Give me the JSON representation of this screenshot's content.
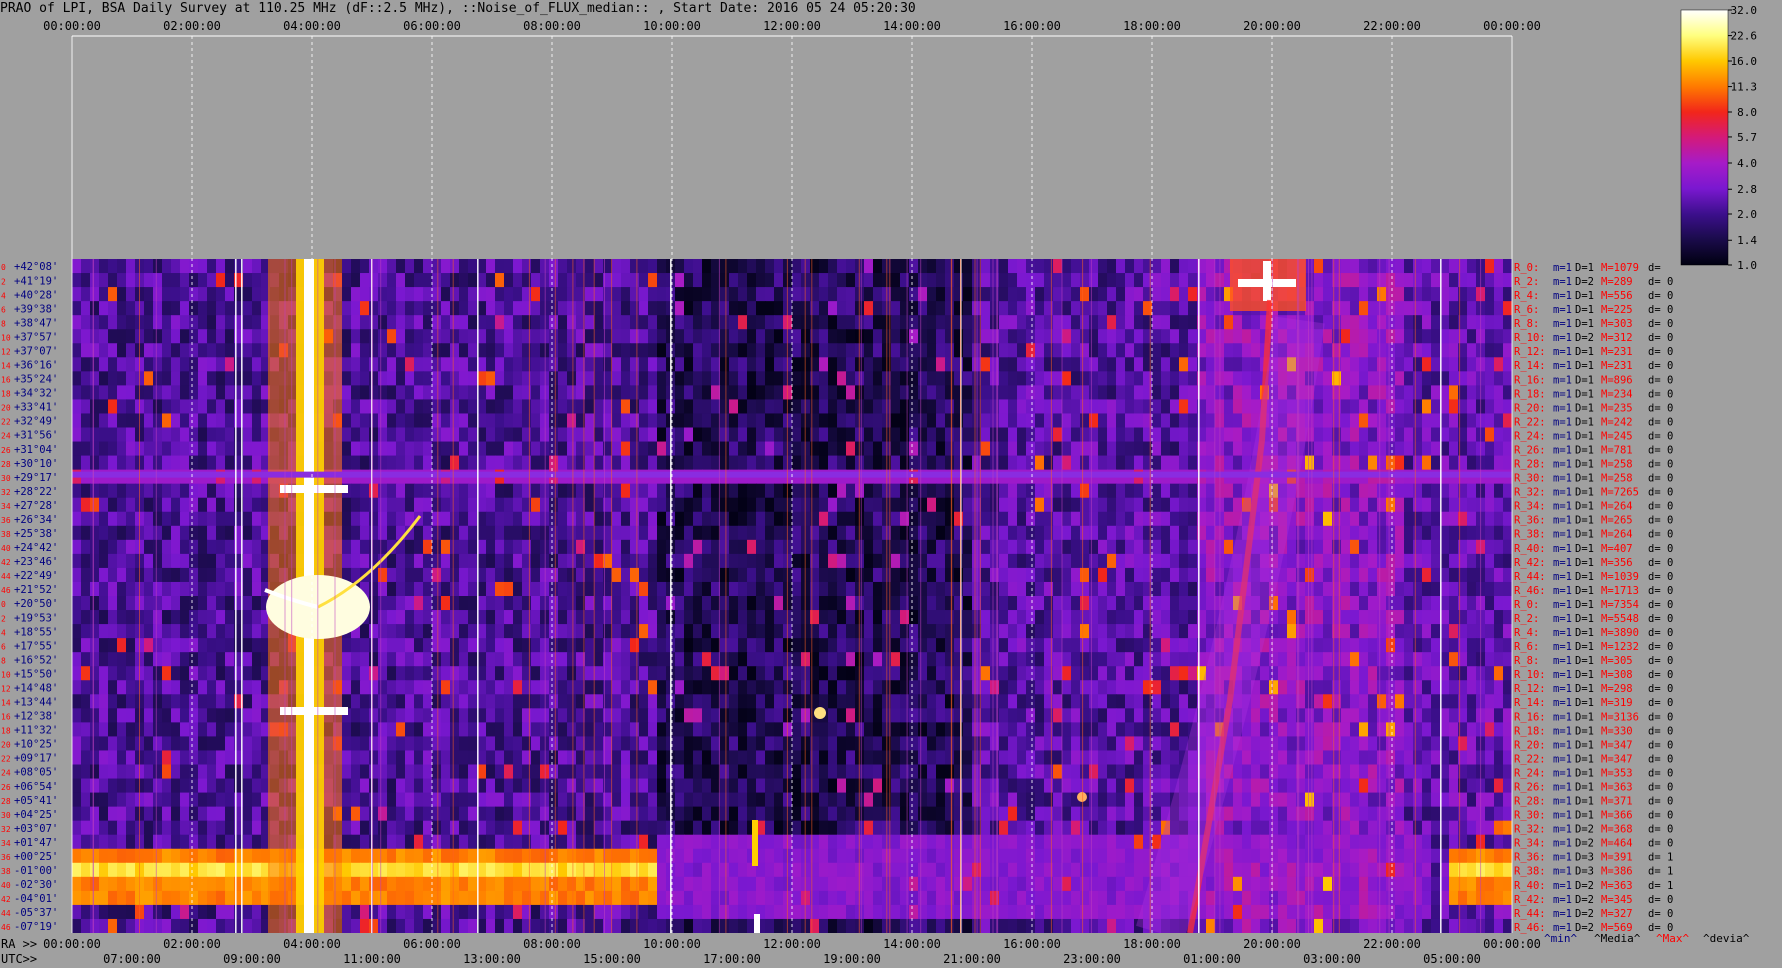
{
  "chart_data": {
    "type": "heatmap",
    "title": "PRAO of LPI, BSA Daily Survey at 110.25 MHz (dF::2.5 MHz), ::Noise_of_FLUX_median:: , Start Date: 2016 05 24 05:20:30",
    "top_axis_ticks": [
      "00:00:00",
      "02:00:00",
      "04:00:00",
      "06:00:00",
      "08:00:00",
      "10:00:00",
      "12:00:00",
      "14:00:00",
      "16:00:00",
      "18:00:00",
      "20:00:00",
      "22:00:00",
      "00:00:00"
    ],
    "ra_axis_label": "RA >>",
    "ra_ticks": [
      "00:00:00",
      "02:00:00",
      "04:00:00",
      "06:00:00",
      "08:00:00",
      "10:00:00",
      "12:00:00",
      "14:00:00",
      "16:00:00",
      "18:00:00",
      "20:00:00",
      "22:00:00",
      "00:00:00"
    ],
    "utc_axis_label": "UTC>>",
    "utc_ticks": [
      "07:00:00",
      "09:00:00",
      "11:00:00",
      "13:00:00",
      "15:00:00",
      "17:00:00",
      "19:00:00",
      "21:00:00",
      "23:00:00",
      "01:00:00",
      "03:00:00",
      "05:00:00"
    ],
    "row_indices": [
      "0",
      "2",
      "4",
      "6",
      "8",
      "10",
      "12",
      "14",
      "16",
      "18",
      "20",
      "22",
      "24",
      "26",
      "28",
      "30",
      "32",
      "34",
      "36",
      "38",
      "40",
      "42",
      "44",
      "46",
      "0",
      "2",
      "4",
      "6",
      "8",
      "10",
      "12",
      "14",
      "16",
      "18",
      "20",
      "22",
      "24",
      "26",
      "28",
      "30",
      "32",
      "34",
      "36",
      "38",
      "40",
      "42",
      "44",
      "46"
    ],
    "declinations": [
      "+42°08'",
      "+41°19'",
      "+40°28'",
      "+39°38'",
      "+38°47'",
      "+37°57'",
      "+37°07'",
      "+36°16'",
      "+35°24'",
      "+34°32'",
      "+33°41'",
      "+32°49'",
      "+31°56'",
      "+31°04'",
      "+30°10'",
      "+29°17'",
      "+28°22'",
      "+27°28'",
      "+26°34'",
      "+25°38'",
      "+24°42'",
      "+23°46'",
      "+22°49'",
      "+21°52'",
      "+20°50'",
      "+19°53'",
      "+18°55'",
      "+17°55'",
      "+16°52'",
      "+15°50'",
      "+14°48'",
      "+13°44'",
      "+12°38'",
      "+11°32'",
      "+10°25'",
      "+09°17'",
      "+08°05'",
      "+06°54'",
      "+05°41'",
      "+04°25'",
      "+03°07'",
      "+01°47'",
      "+00°25'",
      "-01°00'",
      "-02°30'",
      "-04°01'",
      "-05°37'",
      "-07°19'"
    ],
    "right_stats": [
      {
        "r": "R_0:",
        "m": "m=1",
        "d": "D=1",
        "M": "M=1079",
        "e": "d="
      },
      {
        "r": "R_2:",
        "m": "m=1",
        "d": "D=2",
        "M": "M=289",
        "e": "d= 0"
      },
      {
        "r": "R_4:",
        "m": "m=1",
        "d": "D=1",
        "M": "M=556",
        "e": "d= 0"
      },
      {
        "r": "R_6:",
        "m": "m=1",
        "d": "D=1",
        "M": "M=225",
        "e": "d= 0"
      },
      {
        "r": "R_8:",
        "m": "m=1",
        "d": "D=1",
        "M": "M=303",
        "e": "d= 0"
      },
      {
        "r": "R_10:",
        "m": "m=1",
        "d": "D=2",
        "M": "M=312",
        "e": "d= 0"
      },
      {
        "r": "R_12:",
        "m": "m=1",
        "d": "D=1",
        "M": "M=231",
        "e": "d= 0"
      },
      {
        "r": "R_14:",
        "m": "m=1",
        "d": "D=1",
        "M": "M=231",
        "e": "d= 0"
      },
      {
        "r": "R_16:",
        "m": "m=1",
        "d": "D=1",
        "M": "M=896",
        "e": "d= 0"
      },
      {
        "r": "R_18:",
        "m": "m=1",
        "d": "D=1",
        "M": "M=234",
        "e": "d= 0"
      },
      {
        "r": "R_20:",
        "m": "m=1",
        "d": "D=1",
        "M": "M=235",
        "e": "d= 0"
      },
      {
        "r": "R_22:",
        "m": "m=1",
        "d": "D=1",
        "M": "M=242",
        "e": "d= 0"
      },
      {
        "r": "R_24:",
        "m": "m=1",
        "d": "D=1",
        "M": "M=245",
        "e": "d= 0"
      },
      {
        "r": "R_26:",
        "m": "m=1",
        "d": "D=1",
        "M": "M=781",
        "e": "d= 0"
      },
      {
        "r": "R_28:",
        "m": "m=1",
        "d": "D=1",
        "M": "M=258",
        "e": "d= 0"
      },
      {
        "r": "R_30:",
        "m": "m=1",
        "d": "D=1",
        "M": "M=258",
        "e": "d= 0"
      },
      {
        "r": "R_32:",
        "m": "m=1",
        "d": "D=1",
        "M": "M=7265",
        "e": "d= 0"
      },
      {
        "r": "R_34:",
        "m": "m=1",
        "d": "D=1",
        "M": "M=264",
        "e": "d= 0"
      },
      {
        "r": "R_36:",
        "m": "m=1",
        "d": "D=1",
        "M": "M=265",
        "e": "d= 0"
      },
      {
        "r": "R_38:",
        "m": "m=1",
        "d": "D=1",
        "M": "M=264",
        "e": "d= 0"
      },
      {
        "r": "R_40:",
        "m": "m=1",
        "d": "D=1",
        "M": "M=407",
        "e": "d= 0"
      },
      {
        "r": "R_42:",
        "m": "m=1",
        "d": "D=1",
        "M": "M=356",
        "e": "d= 0"
      },
      {
        "r": "R_44:",
        "m": "m=1",
        "d": "D=1",
        "M": "M=1039",
        "e": "d= 0"
      },
      {
        "r": "R_46:",
        "m": "m=1",
        "d": "D=1",
        "M": "M=1713",
        "e": "d= 0"
      },
      {
        "r": "R_0:",
        "m": "m=1",
        "d": "D=1",
        "M": "M=7354",
        "e": "d= 0"
      },
      {
        "r": "R_2:",
        "m": "m=1",
        "d": "D=1",
        "M": "M=5548",
        "e": "d= 0"
      },
      {
        "r": "R_4:",
        "m": "m=1",
        "d": "D=1",
        "M": "M=3890",
        "e": "d= 0"
      },
      {
        "r": "R_6:",
        "m": "m=1",
        "d": "D=1",
        "M": "M=1232",
        "e": "d= 0"
      },
      {
        "r": "R_8:",
        "m": "m=1",
        "d": "D=1",
        "M": "M=305",
        "e": "d= 0"
      },
      {
        "r": "R_10:",
        "m": "m=1",
        "d": "D=1",
        "M": "M=308",
        "e": "d= 0"
      },
      {
        "r": "R_12:",
        "m": "m=1",
        "d": "D=1",
        "M": "M=298",
        "e": "d= 0"
      },
      {
        "r": "R_14:",
        "m": "m=1",
        "d": "D=1",
        "M": "M=319",
        "e": "d= 0"
      },
      {
        "r": "R_16:",
        "m": "m=1",
        "d": "D=1",
        "M": "M=3136",
        "e": "d= 0"
      },
      {
        "r": "R_18:",
        "m": "m=1",
        "d": "D=1",
        "M": "M=330",
        "e": "d= 0"
      },
      {
        "r": "R_20:",
        "m": "m=1",
        "d": "D=1",
        "M": "M=347",
        "e": "d= 0"
      },
      {
        "r": "R_22:",
        "m": "m=1",
        "d": "D=1",
        "M": "M=347",
        "e": "d= 0"
      },
      {
        "r": "R_24:",
        "m": "m=1",
        "d": "D=1",
        "M": "M=353",
        "e": "d= 0"
      },
      {
        "r": "R_26:",
        "m": "m=1",
        "d": "D=1",
        "M": "M=363",
        "e": "d= 0"
      },
      {
        "r": "R_28:",
        "m": "m=1",
        "d": "D=1",
        "M": "M=371",
        "e": "d= 0"
      },
      {
        "r": "R_30:",
        "m": "m=1",
        "d": "D=1",
        "M": "M=366",
        "e": "d= 0"
      },
      {
        "r": "R_32:",
        "m": "m=1",
        "d": "D=2",
        "M": "M=368",
        "e": "d= 0"
      },
      {
        "r": "R_34:",
        "m": "m=1",
        "d": "D=2",
        "M": "M=464",
        "e": "d= 0"
      },
      {
        "r": "R_36:",
        "m": "m=1",
        "d": "D=3",
        "M": "M=391",
        "e": "d= 1"
      },
      {
        "r": "R_38:",
        "m": "m=1",
        "d": "D=3",
        "M": "M=386",
        "e": "d= 1"
      },
      {
        "r": "R_40:",
        "m": "m=1",
        "d": "D=2",
        "M": "M=363",
        "e": "d= 1"
      },
      {
        "r": "R_42:",
        "m": "m=1",
        "d": "D=2",
        "M": "M=345",
        "e": "d= 0"
      },
      {
        "r": "R_44:",
        "m": "m=1",
        "d": "D=2",
        "M": "M=327",
        "e": "d= 0"
      },
      {
        "r": "R_46:",
        "m": "m=1",
        "d": "D=2",
        "M": "M=569",
        "e": "d= 0"
      }
    ],
    "stat_legend": [
      {
        "label": "^min^",
        "color": "#000080"
      },
      {
        "label": "^Media^",
        "color": "#000000"
      },
      {
        "label": "^Max^",
        "color": "#ff0000"
      },
      {
        "label": "^devia^",
        "color": "#000000"
      }
    ],
    "colorbar_ticks": [
      "32.0",
      "22.6",
      "16.0",
      "11.3",
      "8.0",
      "5.7",
      "4.0",
      "2.8",
      "2.0",
      "1.4",
      "1.0"
    ],
    "colorbar_range": [
      1.0,
      32.0
    ],
    "colorbar_scale": "log",
    "colors": {
      "background": "#a0a0a0",
      "row_label": "#000080",
      "row_index": "#ff0000",
      "stat_label": "#ff0000",
      "colormap": [
        "#000010",
        "#1a0b4a",
        "#3c0f8c",
        "#7a18d0",
        "#a61bc8",
        "#d41a7a",
        "#f2261a",
        "#ff7a00",
        "#ffc800",
        "#ffff80",
        "#ffffff"
      ]
    }
  }
}
